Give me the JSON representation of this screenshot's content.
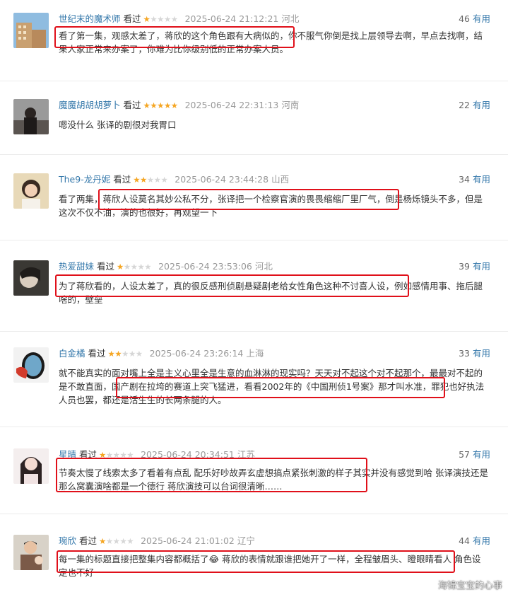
{
  "reviews": [
    {
      "user": "世纪末的魔术师",
      "status": "看过",
      "stars": 1,
      "time": "2025-06-24 21:12:21",
      "location": "河北",
      "votes": "46",
      "useful_label": "有用",
      "avatar": "building-photo",
      "text": "看了第一集，观感太差了，蒋欣的这个角色跟有大病似的，你不服气你倒是找上层领导去啊，早点去找啊，结果人家正常来办案了，你难为比你级别低的正常办案人员。"
    },
    {
      "user": "魔魔胡胡胡萝卜",
      "status": "看过",
      "stars": 5,
      "time": "2025-06-24 22:31:13",
      "location": "河南",
      "votes": "22",
      "useful_label": "有用",
      "avatar": "person-dark-photo",
      "text": "嗯没什么 张译的剧很对我胃口"
    },
    {
      "user": "The9-龙丹妮",
      "status": "看过",
      "stars": 2,
      "time": "2025-06-24 23:44:28",
      "location": "山西",
      "votes": "34",
      "useful_label": "有用",
      "avatar": "girl-portrait-photo",
      "text": "看了两集，蒋欣人设莫名其妙公私不分，张译把一个检察官演的畏畏缩缩厂里厂气，倒是杨烁镜头不多，但是这次不仅不油，演的也很好，再观望一下"
    },
    {
      "user": "热爱甜妹",
      "status": "看过",
      "stars": 1,
      "time": "2025-06-24 23:53:06",
      "location": "河北",
      "votes": "39",
      "useful_label": "有用",
      "avatar": "anime-girl-photo",
      "text": "为了蒋欣看的，人设太差了，真的很反感刑侦剧悬疑剧老给女性角色这种不讨喜人设，例如感情用事、拖后腿啥的，壁垒"
    },
    {
      "user": "白金橘",
      "status": "看过",
      "stars": 2,
      "time": "2025-06-24 23:26:14",
      "location": "上海",
      "votes": "33",
      "useful_label": "有用",
      "avatar": "mirror-photo",
      "text": "就不能真实的面对嘴上全是主义心里全是生意的血淋淋的现实吗？天天对不起这个对不起那个，最最对不起的是不敢直面，国产剧在拉垮的赛道上突飞猛进，看看2002年的《中国刑侦1号案》那才叫水准，罪犯也好执法人员也罢，都还是活生生的长两条腿的人。"
    },
    {
      "user": "星晴",
      "status": "看过",
      "stars": 1,
      "time": "2025-06-24 20:34:51",
      "location": "江苏",
      "votes": "57",
      "useful_label": "有用",
      "avatar": "woman-portrait-photo",
      "text": "节奏太慢了线索太多了看着有点乱 配乐好吵故弄玄虚想搞点紧张刺激的样子其实并没有感觉到哈 张译演技还是那么窝囊演啥都是一个德行 蒋欣演技可以台词很清晰……"
    },
    {
      "user": "琬欣",
      "status": "看过",
      "stars": 1,
      "time": "2025-06-24 21:01:02",
      "location": "辽宁",
      "votes": "44",
      "useful_label": "有用",
      "avatar": "man-portrait-photo",
      "text": "每一集的标题直接把整集内容都概括了😂 蒋欣的表情就跟谁把她开了一样，全程皱眉头、瞪眼睛看人 角色设定也不好"
    }
  ],
  "watermark": "海锦宝宝的心事"
}
